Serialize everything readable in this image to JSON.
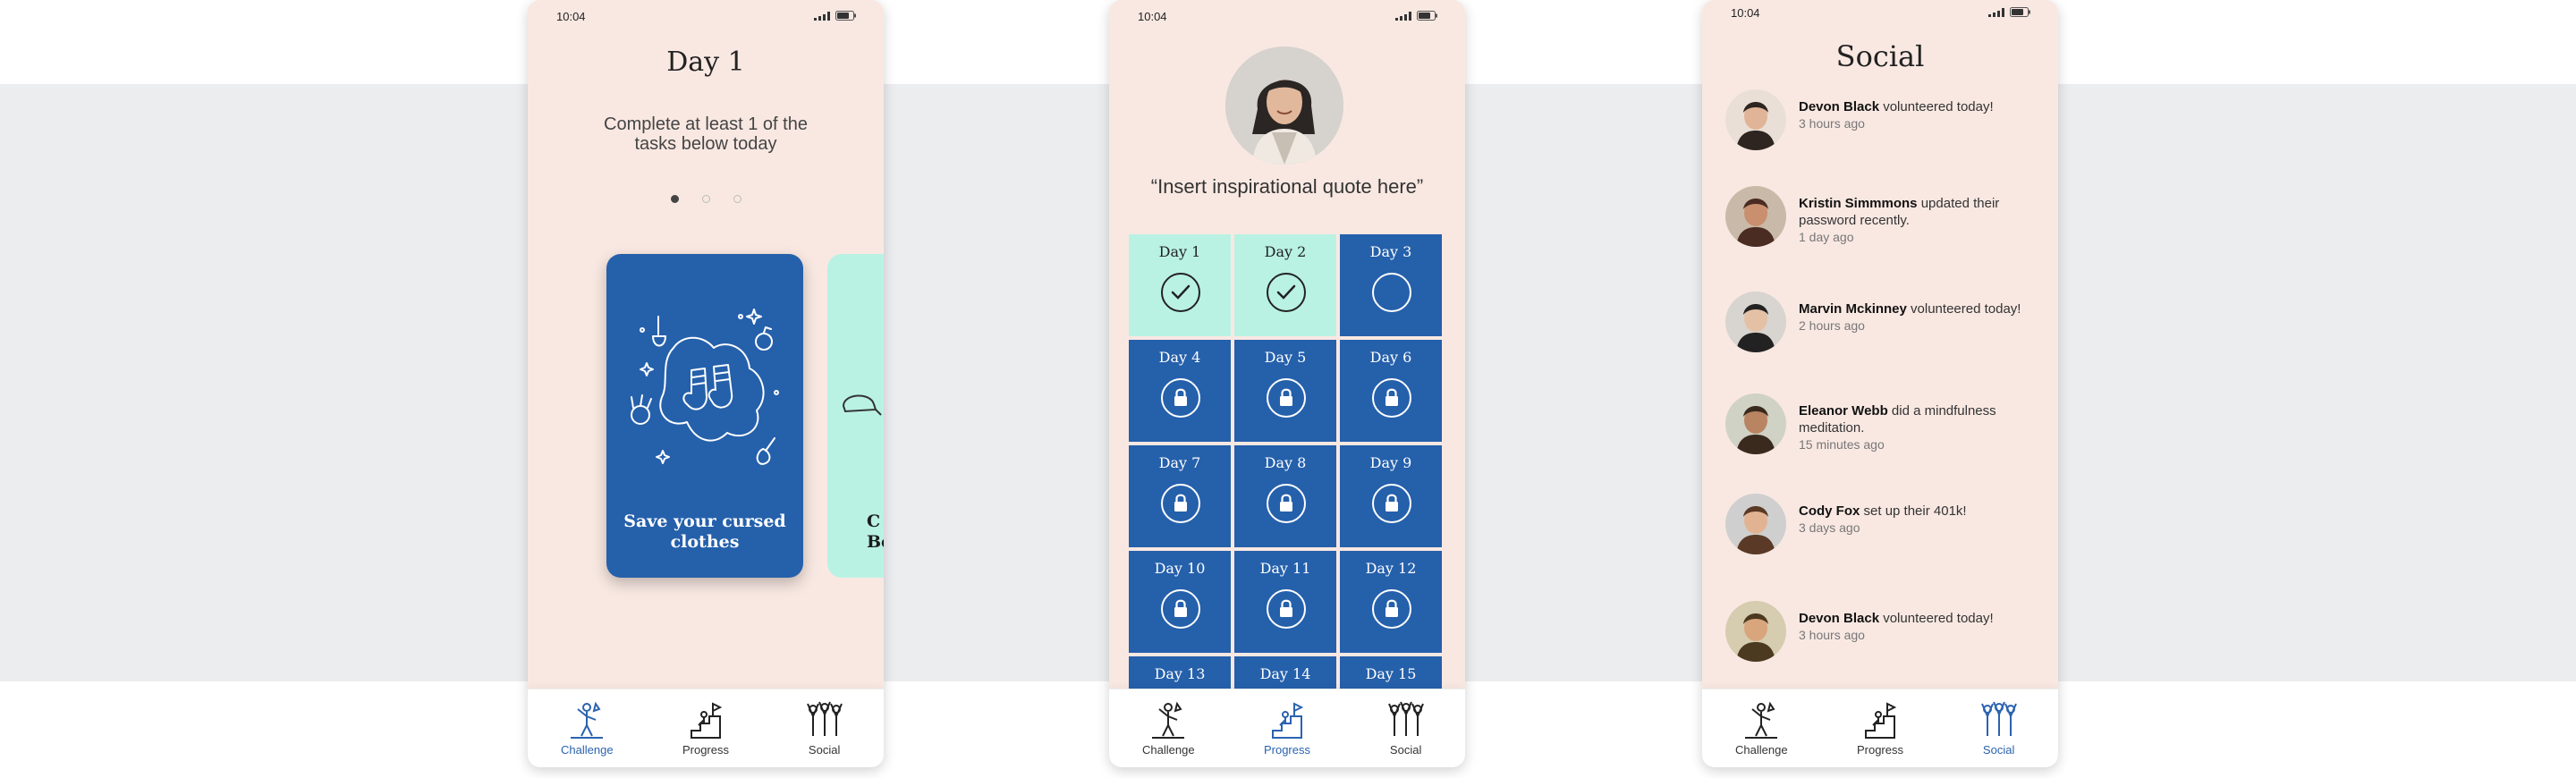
{
  "status_time_1": "10:04",
  "status_time_2": "10:04",
  "status_time_3": "10:04",
  "challenge": {
    "title": "Day 1",
    "subtitle": "Complete at least 1 of the tasks below today",
    "cards": [
      {
        "title": "Save your cursed clothes"
      },
      {
        "title": "C\nBe"
      }
    ]
  },
  "progress": {
    "quote": "“Insert inspirational quote here”",
    "days": [
      {
        "label": "Day 1",
        "state": "done"
      },
      {
        "label": "Day 2",
        "state": "done"
      },
      {
        "label": "Day 3",
        "state": "current"
      },
      {
        "label": "Day 4",
        "state": "locked"
      },
      {
        "label": "Day 5",
        "state": "locked"
      },
      {
        "label": "Day 6",
        "state": "locked"
      },
      {
        "label": "Day 7",
        "state": "locked"
      },
      {
        "label": "Day 8",
        "state": "locked"
      },
      {
        "label": "Day 9",
        "state": "locked"
      },
      {
        "label": "Day 10",
        "state": "locked"
      },
      {
        "label": "Day 11",
        "state": "locked"
      },
      {
        "label": "Day 12",
        "state": "locked"
      },
      {
        "label": "Day 13",
        "state": "locked"
      },
      {
        "label": "Day 14",
        "state": "locked"
      },
      {
        "label": "Day 15",
        "state": "locked"
      }
    ]
  },
  "social": {
    "title": "Social",
    "feed": [
      {
        "name": "Devon Black",
        "action": " volunteered today!",
        "time": "3 hours ago"
      },
      {
        "name": "Kristin Simmmons",
        "action": " updated their password recently.",
        "time": "1 day ago"
      },
      {
        "name": "Marvin Mckinney",
        "action": " volunteered today!",
        "time": "2 hours ago"
      },
      {
        "name": "Eleanor Webb",
        "action": " did a mindfulness meditation.",
        "time": "15 minutes ago"
      },
      {
        "name": "Cody Fox",
        "action": " set up their 401k!",
        "time": "3 days ago"
      },
      {
        "name": "Devon Black",
        "action": " volunteered today!",
        "time": "3 hours ago"
      }
    ]
  },
  "tabs": [
    {
      "label": "Challenge",
      "icon": "challenge-icon"
    },
    {
      "label": "Progress",
      "icon": "progress-icon"
    },
    {
      "label": "Social",
      "icon": "social-icon"
    }
  ],
  "colors": {
    "blue": "#2560ab",
    "mint": "#b9f2e3",
    "background": "#f9e8e2",
    "active_tab": "#2b63b0"
  }
}
